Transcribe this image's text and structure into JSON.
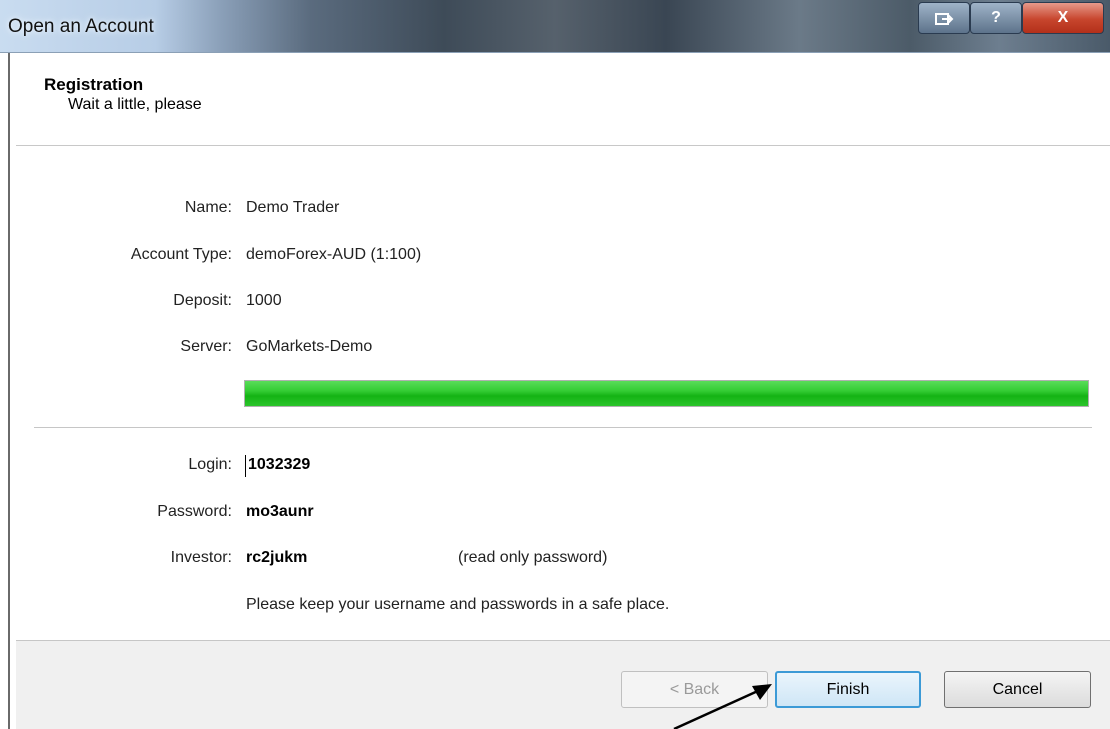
{
  "window": {
    "title": "Open an Account",
    "controls": {
      "restore_icon": "restore-icon",
      "help_label": "?",
      "close_label": "X"
    }
  },
  "header": {
    "title": "Registration",
    "subtitle": "Wait a little, please"
  },
  "details": {
    "name_label": "Name:",
    "name_value": "Demo Trader",
    "account_type_label": "Account Type:",
    "account_type_value": "demoForex-AUD (1:100)",
    "deposit_label": "Deposit:",
    "deposit_value": "1000",
    "server_label": "Server:",
    "server_value": "GoMarkets-Demo"
  },
  "progress": {
    "fraction": 1.0,
    "color": "#22c022"
  },
  "credentials": {
    "login_label": "Login:",
    "login_value": "1032329",
    "password_label": "Password:",
    "password_value": "mo3aunr",
    "investor_label": "Investor:",
    "investor_value": "rc2jukm",
    "investor_note": "(read only password)",
    "safety_note": "Please keep your username and passwords in a safe place."
  },
  "buttons": {
    "back_label": "< Back",
    "finish_label": "Finish",
    "cancel_label": "Cancel"
  }
}
